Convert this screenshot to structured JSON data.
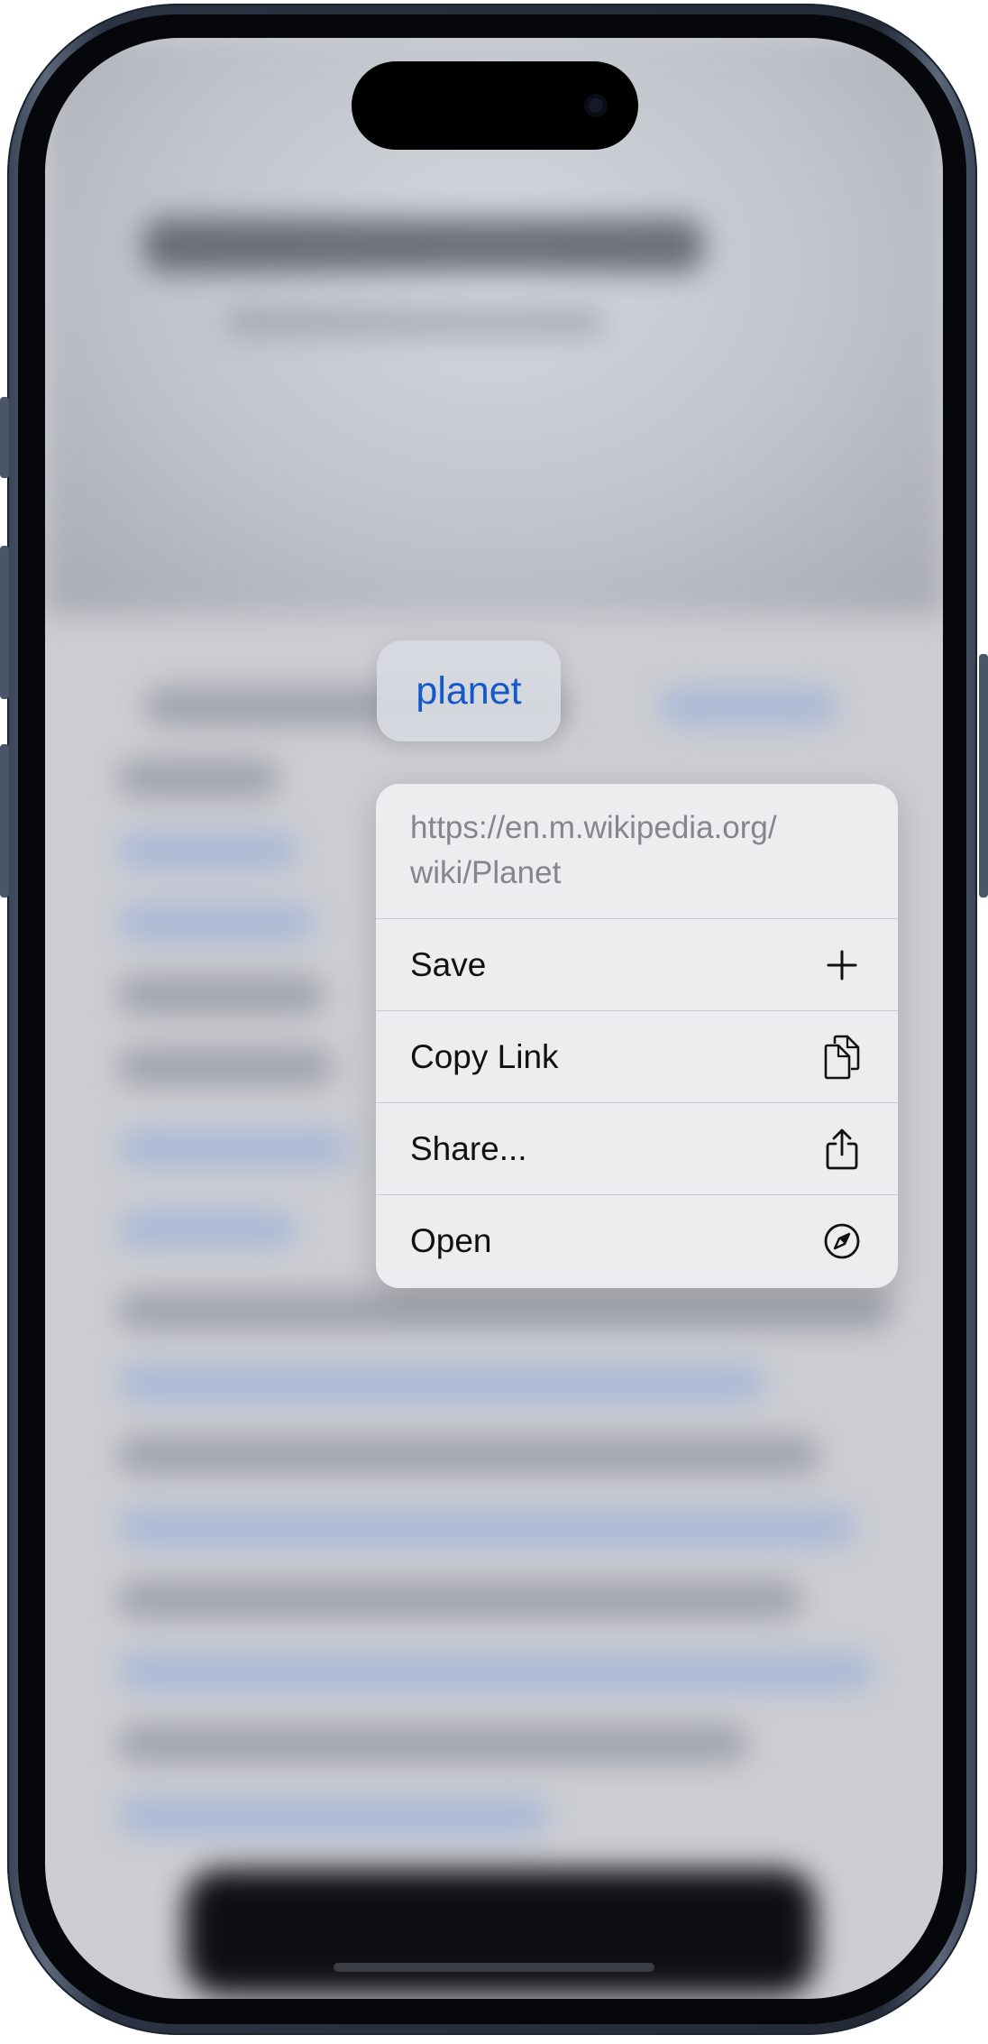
{
  "link_preview": {
    "text": "planet",
    "color": "#1558c9"
  },
  "context_menu": {
    "url": "https://en.m.wikipedia.org/wiki/Planet",
    "url_line1": "https://en.m.wikipedia.org/",
    "url_line2": "wiki/Planet",
    "items": [
      {
        "label": "Save",
        "icon": "plus-icon"
      },
      {
        "label": "Copy Link",
        "icon": "copy-icon"
      },
      {
        "label": "Share...",
        "icon": "share-icon"
      },
      {
        "label": "Open",
        "icon": "compass-icon"
      }
    ]
  }
}
